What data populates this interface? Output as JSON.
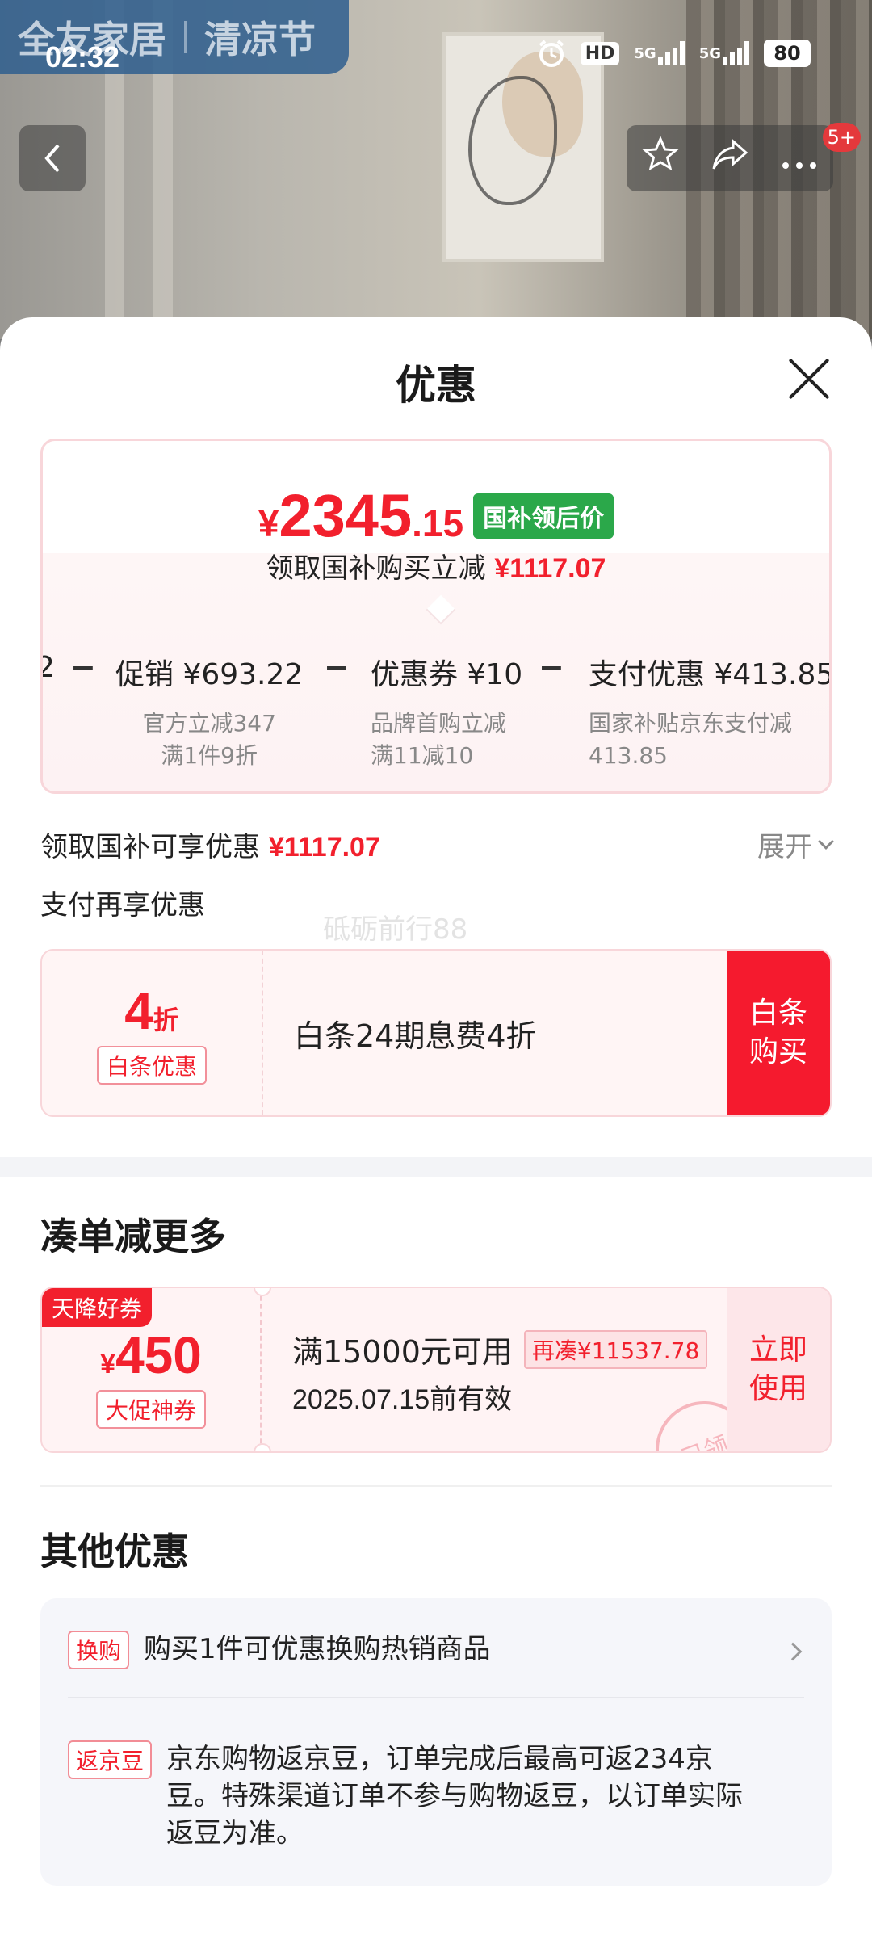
{
  "status_bar": {
    "time": "02:32",
    "hd": "HD",
    "network_1": "5G",
    "network_2": "5G",
    "battery": "80"
  },
  "background": {
    "banner_brand": "全友家居",
    "banner_event": "清凉节",
    "message_badge": "5+"
  },
  "sheet": {
    "title": "优惠"
  },
  "price_card": {
    "currency": "¥",
    "price_int": "2345",
    "price_dec": ".15",
    "price_tag": "国补领后价",
    "subtitle_prefix": "领取国补购买立减",
    "subtitle_amount": "¥1117.07",
    "breakdown": [
      {
        "label": "促销 ¥693.22",
        "desc_1": "官方立减347",
        "desc_2": "满1件9折"
      },
      {
        "label": "优惠券 ¥10",
        "desc_1": "品牌首购立减",
        "desc_2": "满11减10"
      },
      {
        "label": "支付优惠 ¥413.85",
        "desc_1": "国家补贴京东支付减",
        "desc_2": "413.85"
      }
    ],
    "cut_char": "2",
    "minus": "−"
  },
  "subsidy_row": {
    "label": "领取国补可享优惠",
    "amount": "¥1117.07",
    "expand_label": "展开"
  },
  "payment_row": {
    "label": "支付再享优惠"
  },
  "watermark": "砥砺前行88",
  "baitiao": {
    "discount_num": "4",
    "discount_unit": "折",
    "tag": "白条优惠",
    "desc": "白条24期息费4折",
    "button": "白条购买"
  },
  "bundle_section": {
    "title": "凑单减更多",
    "coupon": {
      "badge": "天降好券",
      "symbol": "¥",
      "amount": "450",
      "type": "大促神券",
      "condition": "满15000元可用",
      "chip": "再凑¥11537.78",
      "expiry": "2025.07.15前有效",
      "button": "立即使用",
      "stamp": "已领"
    }
  },
  "other_section": {
    "title": "其他优惠",
    "items": [
      {
        "tag": "换购",
        "text": "购买1件可优惠换购热销商品"
      },
      {
        "tag": "返京豆",
        "text": "京东购物返京豆，订单完成后最高可返234京豆。特殊渠道订单不参与购物返豆，以订单实际返豆为准。"
      }
    ]
  }
}
